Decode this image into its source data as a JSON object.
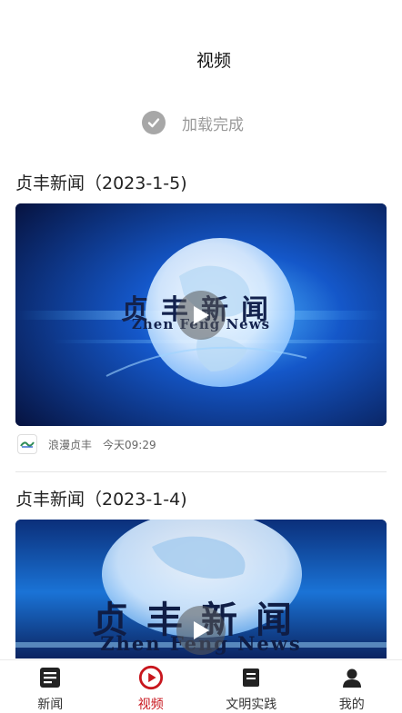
{
  "header": {
    "title": "视频"
  },
  "refresh": {
    "status_text": "加载完成",
    "icon": "check-circle-icon"
  },
  "feed": {
    "items": [
      {
        "title": "贞丰新闻（2023-1-5)",
        "thumbnail_caption_cn": "贞丰新闻",
        "thumbnail_caption_en": "Zhen Feng News",
        "source": "浪漫贞丰",
        "time": "今天09:29"
      },
      {
        "title": "贞丰新闻（2023-1-4)",
        "thumbnail_caption_cn": "贞丰新闻",
        "thumbnail_caption_en": "Zhen Feng News"
      }
    ]
  },
  "tabbar": {
    "tabs": [
      {
        "label": "新闻",
        "icon": "news-icon",
        "active": false
      },
      {
        "label": "视频",
        "icon": "play-circle-icon",
        "active": true
      },
      {
        "label": "文明实践",
        "icon": "practice-icon",
        "active": false
      },
      {
        "label": "我的",
        "icon": "profile-icon",
        "active": false
      }
    ]
  },
  "colors": {
    "accent": "#c8161d",
    "muted": "#9a9a9a",
    "thumb_dark": "#0a1a4a",
    "thumb_glow": "#36a8ff"
  }
}
